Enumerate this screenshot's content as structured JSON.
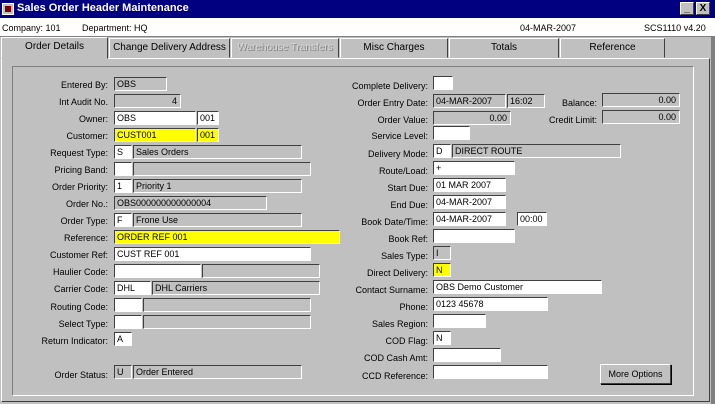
{
  "window": {
    "title": "Sales Order Header Maintenance",
    "minimize": "_",
    "close": "X"
  },
  "infobar": {
    "company": "Company: 101",
    "department": "Department: HQ",
    "date": "04-MAR-2007",
    "screen": "SCS1110 v4.20"
  },
  "tabs": [
    {
      "label": "Order Details"
    },
    {
      "label": "Change Delivery Address"
    },
    {
      "label": "Warehouse Transfers"
    },
    {
      "label": "Misc Charges"
    },
    {
      "label": "Totals"
    },
    {
      "label": "Reference"
    }
  ],
  "left": {
    "entered_by": {
      "label": "Entered By:",
      "value": "OBS"
    },
    "audit_no": {
      "label": "Int Audit No.",
      "value": "4"
    },
    "owner": {
      "label": "Owner:",
      "value": "OBS",
      "value2": "001"
    },
    "customer": {
      "label": "Customer:",
      "value": "CUST001",
      "value2": "001"
    },
    "request_type": {
      "label": "Request Type:",
      "code": "S",
      "desc": "Sales Orders"
    },
    "pricing_band": {
      "label": "Pricing Band:",
      "code": "",
      "desc": ""
    },
    "order_priority": {
      "label": "Order Priority:",
      "code": "1",
      "desc": "Priority 1"
    },
    "order_no": {
      "label": "Order No.:",
      "value": "OBS000000000000004"
    },
    "order_type": {
      "label": "Order Type:",
      "code": "F",
      "desc": "Frone Use"
    },
    "reference": {
      "label": "Reference:",
      "value": "ORDER REF 001"
    },
    "customer_ref": {
      "label": "Customer Ref:",
      "value": "CUST REF 001"
    },
    "haulier_code": {
      "label": "Haulier Code:",
      "code": "",
      "desc": ""
    },
    "carrier_code": {
      "label": "Carrier Code:",
      "code": "DHL",
      "desc": "DHL Carriers"
    },
    "routing_code": {
      "label": "Routing Code:",
      "code": "",
      "desc": ""
    },
    "select_type": {
      "label": "Select Type:",
      "code": "",
      "desc": ""
    },
    "return_indicator": {
      "label": "Return Indicator:",
      "value": "A"
    },
    "order_status": {
      "label": "Order Status:",
      "code": "U",
      "desc": "Order Entered"
    }
  },
  "right": {
    "complete_delivery": {
      "label": "Complete Delivery:",
      "value": ""
    },
    "order_entry_date": {
      "label": "Order Entry Date:",
      "date": "04-MAR-2007",
      "time": "16:02"
    },
    "balance": {
      "label": "Balance:",
      "value": "0.00"
    },
    "order_value": {
      "label": "Order Value:",
      "value": "0.00"
    },
    "credit_limit": {
      "label": "Credit Limit:",
      "value": "0.00"
    },
    "service_level": {
      "label": "Service Level:",
      "value": ""
    },
    "delivery_mode": {
      "label": "Delivery Mode:",
      "code": "D",
      "desc": "DIRECT ROUTE"
    },
    "route_load": {
      "label": "Route/Load:",
      "value": "+"
    },
    "start_due": {
      "label": "Start Due:",
      "value": "01 MAR 2007"
    },
    "end_due": {
      "label": "End Due:",
      "value": "04-MAR-2007"
    },
    "book_date": {
      "label": "Book Date/Time:",
      "date": "04-MAR-2007",
      "time": "00:00"
    },
    "book_ref": {
      "label": "Book Ref:",
      "value": ""
    },
    "sales_type": {
      "label": "Sales Type:",
      "value": "I"
    },
    "direct_delivery": {
      "label": "Direct Delivery:",
      "value": "N"
    },
    "contact_surname": {
      "label": "Contact Surname:",
      "value": "OBS Demo Customer"
    },
    "phone": {
      "label": "Phone:",
      "value": "0123 45678"
    },
    "sales_region": {
      "label": "Sales Region:",
      "value": ""
    },
    "cod_flag": {
      "label": "COD Flag:",
      "value": "N"
    },
    "cod_cash_amt": {
      "label": "COD Cash Amt:",
      "value": ""
    },
    "ccd_reference": {
      "label": "CCD Reference:",
      "value": ""
    }
  },
  "buttons": {
    "more_options": "More Options"
  }
}
